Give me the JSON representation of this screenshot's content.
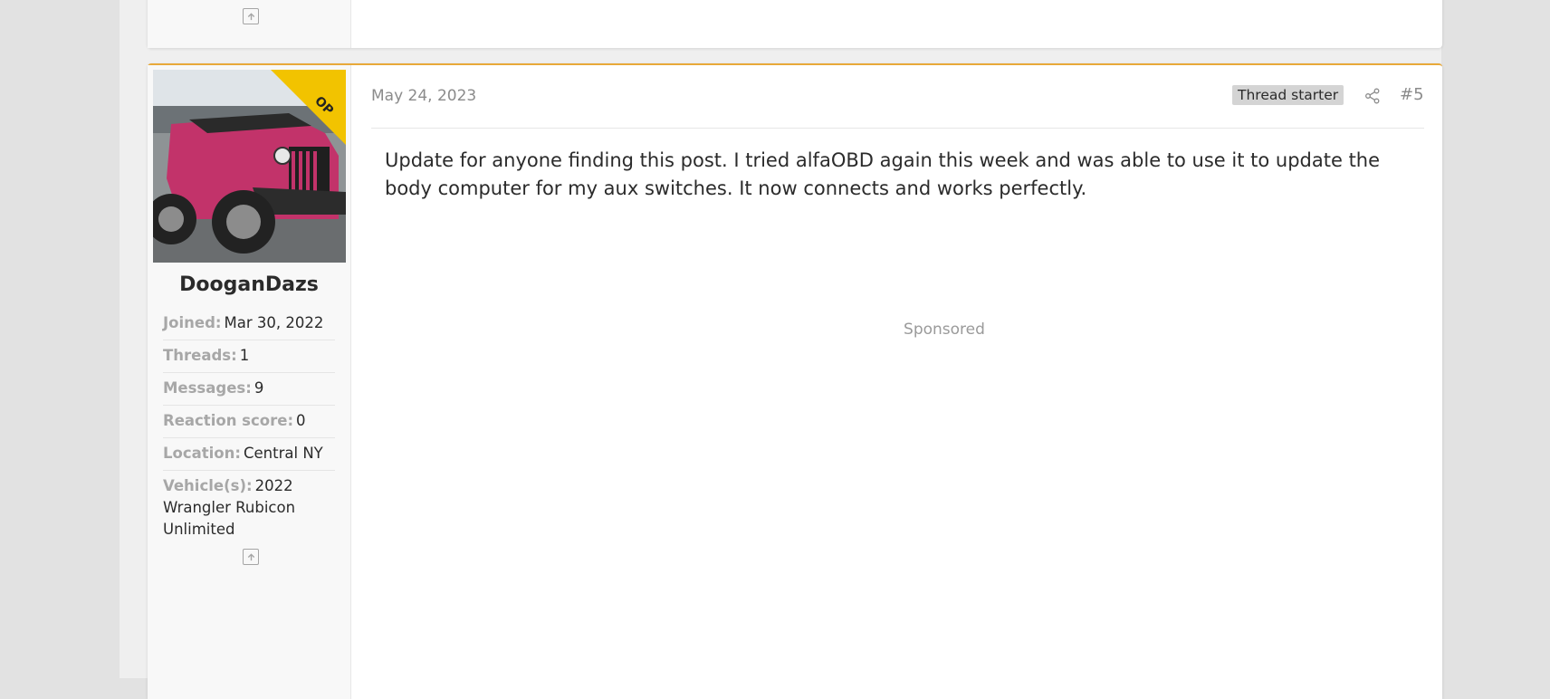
{
  "previous_post": {
    "icons": {
      "scroll_top": "arrow-up-square-icon"
    }
  },
  "post": {
    "author": {
      "avatar_icon": "jeep-wrangler-avatar",
      "op_badge": "OP",
      "username": "DooganDazs",
      "stats": [
        {
          "term": "Joined:",
          "value": "Mar 30, 2022"
        },
        {
          "term": "Threads:",
          "value": "1"
        },
        {
          "term": "Messages:",
          "value": "9"
        },
        {
          "term": "Reaction score:",
          "value": "0"
        },
        {
          "term": "Location:",
          "value": "Central NY"
        },
        {
          "term": "Vehicle(s):",
          "value": "2022 Wrangler Rubicon Unlimited"
        }
      ]
    },
    "date": "May 24, 2023",
    "thread_starter_label": "Thread starter",
    "post_number": "#5",
    "body": "Update for anyone finding this post. I tried alfaOBD again this week and was able to use it to update the body computer for my aux switches. It now connects and works perfectly.",
    "sponsored_label": "Sponsored",
    "icons": {
      "share": "share-icon",
      "scroll_top": "arrow-up-square-icon"
    },
    "colors": {
      "accent_border": "#e8a93a",
      "op_ribbon": "#f2c300",
      "avatar_vehicle": "#c2336a"
    }
  }
}
